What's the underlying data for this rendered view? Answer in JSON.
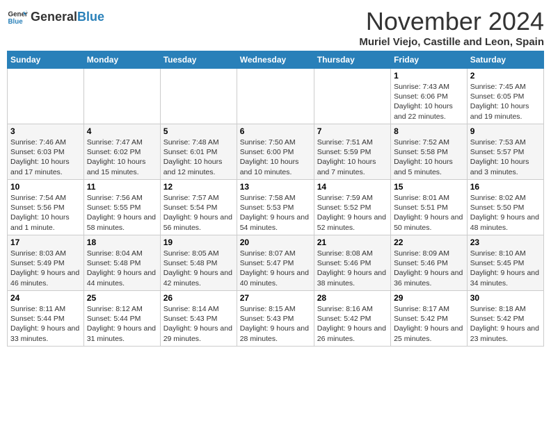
{
  "logo": {
    "general": "General",
    "blue": "Blue"
  },
  "title": "November 2024",
  "subtitle": "Muriel Viejo, Castille and Leon, Spain",
  "days_of_week": [
    "Sunday",
    "Monday",
    "Tuesday",
    "Wednesday",
    "Thursday",
    "Friday",
    "Saturday"
  ],
  "weeks": [
    [
      {
        "day": "",
        "info": ""
      },
      {
        "day": "",
        "info": ""
      },
      {
        "day": "",
        "info": ""
      },
      {
        "day": "",
        "info": ""
      },
      {
        "day": "",
        "info": ""
      },
      {
        "day": "1",
        "info": "Sunrise: 7:43 AM\nSunset: 6:06 PM\nDaylight: 10 hours and 22 minutes."
      },
      {
        "day": "2",
        "info": "Sunrise: 7:45 AM\nSunset: 6:05 PM\nDaylight: 10 hours and 19 minutes."
      }
    ],
    [
      {
        "day": "3",
        "info": "Sunrise: 7:46 AM\nSunset: 6:03 PM\nDaylight: 10 hours and 17 minutes."
      },
      {
        "day": "4",
        "info": "Sunrise: 7:47 AM\nSunset: 6:02 PM\nDaylight: 10 hours and 15 minutes."
      },
      {
        "day": "5",
        "info": "Sunrise: 7:48 AM\nSunset: 6:01 PM\nDaylight: 10 hours and 12 minutes."
      },
      {
        "day": "6",
        "info": "Sunrise: 7:50 AM\nSunset: 6:00 PM\nDaylight: 10 hours and 10 minutes."
      },
      {
        "day": "7",
        "info": "Sunrise: 7:51 AM\nSunset: 5:59 PM\nDaylight: 10 hours and 7 minutes."
      },
      {
        "day": "8",
        "info": "Sunrise: 7:52 AM\nSunset: 5:58 PM\nDaylight: 10 hours and 5 minutes."
      },
      {
        "day": "9",
        "info": "Sunrise: 7:53 AM\nSunset: 5:57 PM\nDaylight: 10 hours and 3 minutes."
      }
    ],
    [
      {
        "day": "10",
        "info": "Sunrise: 7:54 AM\nSunset: 5:56 PM\nDaylight: 10 hours and 1 minute."
      },
      {
        "day": "11",
        "info": "Sunrise: 7:56 AM\nSunset: 5:55 PM\nDaylight: 9 hours and 58 minutes."
      },
      {
        "day": "12",
        "info": "Sunrise: 7:57 AM\nSunset: 5:54 PM\nDaylight: 9 hours and 56 minutes."
      },
      {
        "day": "13",
        "info": "Sunrise: 7:58 AM\nSunset: 5:53 PM\nDaylight: 9 hours and 54 minutes."
      },
      {
        "day": "14",
        "info": "Sunrise: 7:59 AM\nSunset: 5:52 PM\nDaylight: 9 hours and 52 minutes."
      },
      {
        "day": "15",
        "info": "Sunrise: 8:01 AM\nSunset: 5:51 PM\nDaylight: 9 hours and 50 minutes."
      },
      {
        "day": "16",
        "info": "Sunrise: 8:02 AM\nSunset: 5:50 PM\nDaylight: 9 hours and 48 minutes."
      }
    ],
    [
      {
        "day": "17",
        "info": "Sunrise: 8:03 AM\nSunset: 5:49 PM\nDaylight: 9 hours and 46 minutes."
      },
      {
        "day": "18",
        "info": "Sunrise: 8:04 AM\nSunset: 5:48 PM\nDaylight: 9 hours and 44 minutes."
      },
      {
        "day": "19",
        "info": "Sunrise: 8:05 AM\nSunset: 5:48 PM\nDaylight: 9 hours and 42 minutes."
      },
      {
        "day": "20",
        "info": "Sunrise: 8:07 AM\nSunset: 5:47 PM\nDaylight: 9 hours and 40 minutes."
      },
      {
        "day": "21",
        "info": "Sunrise: 8:08 AM\nSunset: 5:46 PM\nDaylight: 9 hours and 38 minutes."
      },
      {
        "day": "22",
        "info": "Sunrise: 8:09 AM\nSunset: 5:46 PM\nDaylight: 9 hours and 36 minutes."
      },
      {
        "day": "23",
        "info": "Sunrise: 8:10 AM\nSunset: 5:45 PM\nDaylight: 9 hours and 34 minutes."
      }
    ],
    [
      {
        "day": "24",
        "info": "Sunrise: 8:11 AM\nSunset: 5:44 PM\nDaylight: 9 hours and 33 minutes."
      },
      {
        "day": "25",
        "info": "Sunrise: 8:12 AM\nSunset: 5:44 PM\nDaylight: 9 hours and 31 minutes."
      },
      {
        "day": "26",
        "info": "Sunrise: 8:14 AM\nSunset: 5:43 PM\nDaylight: 9 hours and 29 minutes."
      },
      {
        "day": "27",
        "info": "Sunrise: 8:15 AM\nSunset: 5:43 PM\nDaylight: 9 hours and 28 minutes."
      },
      {
        "day": "28",
        "info": "Sunrise: 8:16 AM\nSunset: 5:42 PM\nDaylight: 9 hours and 26 minutes."
      },
      {
        "day": "29",
        "info": "Sunrise: 8:17 AM\nSunset: 5:42 PM\nDaylight: 9 hours and 25 minutes."
      },
      {
        "day": "30",
        "info": "Sunrise: 8:18 AM\nSunset: 5:42 PM\nDaylight: 9 hours and 23 minutes."
      }
    ]
  ]
}
